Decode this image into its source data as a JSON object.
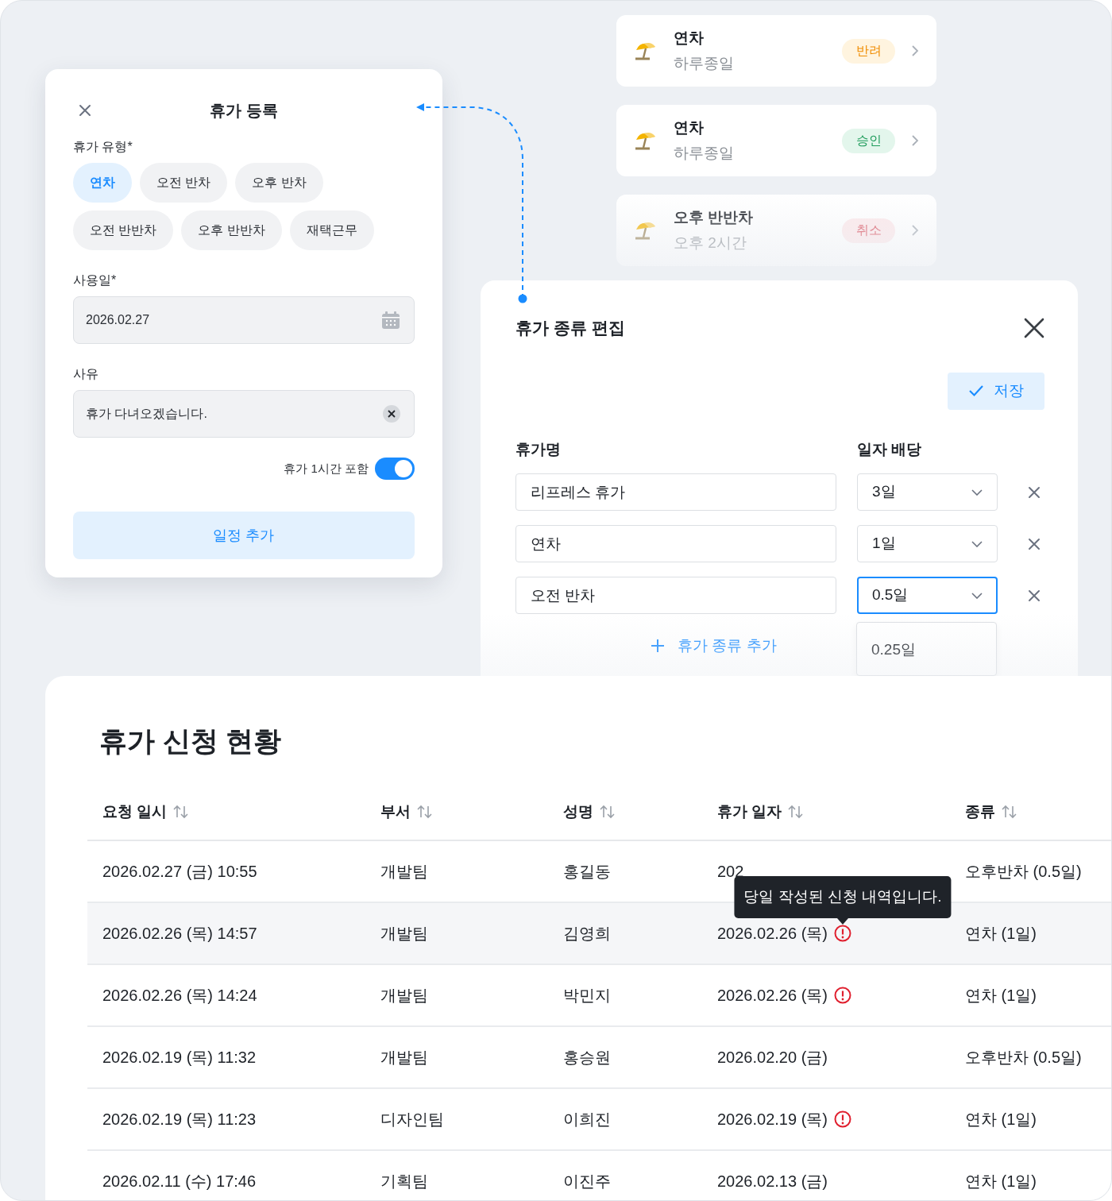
{
  "status_cards": [
    {
      "title": "연차",
      "subtitle": "하루종일",
      "status": "반려",
      "kind": "rejected"
    },
    {
      "title": "연차",
      "subtitle": "하루종일",
      "status": "승인",
      "kind": "approved"
    },
    {
      "title": "오후 반반차",
      "subtitle": "오후 2시간",
      "status": "취소",
      "kind": "cancelled"
    }
  ],
  "register_dialog": {
    "title": "휴가 등록",
    "type_label": "휴가 유형*",
    "types": [
      {
        "label": "연차",
        "selected": true
      },
      {
        "label": "오전 반차",
        "selected": false
      },
      {
        "label": "오후 반차",
        "selected": false
      },
      {
        "label": "오전 반반차",
        "selected": false
      },
      {
        "label": "오후 반반차",
        "selected": false
      },
      {
        "label": "재택근무",
        "selected": false
      }
    ],
    "date_label": "사용일*",
    "date_value": "2026.02.27",
    "reason_label": "사유",
    "reason_value": "휴가 다녀오겠습니다.",
    "toggle": {
      "label": "휴가 1시간 포함",
      "on": true
    },
    "submit": "일정 추가"
  },
  "edit_panel": {
    "title": "휴가 종류 편집",
    "save": "저장",
    "columns": [
      "휴가명",
      "일자 배당"
    ],
    "rows": [
      {
        "name": "리프레스 휴가",
        "days": "3일",
        "focused": false
      },
      {
        "name": "연차",
        "days": "1일",
        "focused": false
      },
      {
        "name": "오전 반차",
        "days": "0.5일",
        "focused": true
      }
    ],
    "dropdown_options": [
      "0.25일"
    ],
    "add_button": "휴가 종류 추가"
  },
  "table": {
    "title": "휴가 신청 현황",
    "columns": [
      "요청 일시",
      "부서",
      "성명",
      "휴가 일자",
      "종류"
    ],
    "rows": [
      {
        "cells": [
          "2026.02.27 (금) 10:55",
          "개발팀",
          "홍길동",
          "202",
          "오후반차 (0.5일)"
        ],
        "warning": false,
        "highlighted": false
      },
      {
        "cells": [
          "2026.02.26 (목) 14:57",
          "개발팀",
          "김영희",
          "2026.02.26 (목)",
          "연차 (1일)"
        ],
        "warning": true,
        "highlighted": true,
        "tooltip": "당일 작성된 신청 내역입니다."
      },
      {
        "cells": [
          "2026.02.26 (목) 14:24",
          "개발팀",
          "박민지",
          "2026.02.26 (목)",
          "연차 (1일)"
        ],
        "warning": true,
        "highlighted": false
      },
      {
        "cells": [
          "2026.02.19 (목) 11:32",
          "개발팀",
          "홍승원",
          "2026.02.20 (금)",
          "오후반차 (0.5일)"
        ],
        "warning": false,
        "highlighted": false
      },
      {
        "cells": [
          "2026.02.19 (목) 11:23",
          "디자인팀",
          "이희진",
          "2026.02.19 (목)",
          "연차 (1일)"
        ],
        "warning": true,
        "highlighted": false
      },
      {
        "cells": [
          "2026.02.11 (수) 17:46",
          "기획팀",
          "이진주",
          "2026.02.13 (금)",
          "연차 (1일)"
        ],
        "warning": false,
        "highlighted": false
      }
    ]
  }
}
